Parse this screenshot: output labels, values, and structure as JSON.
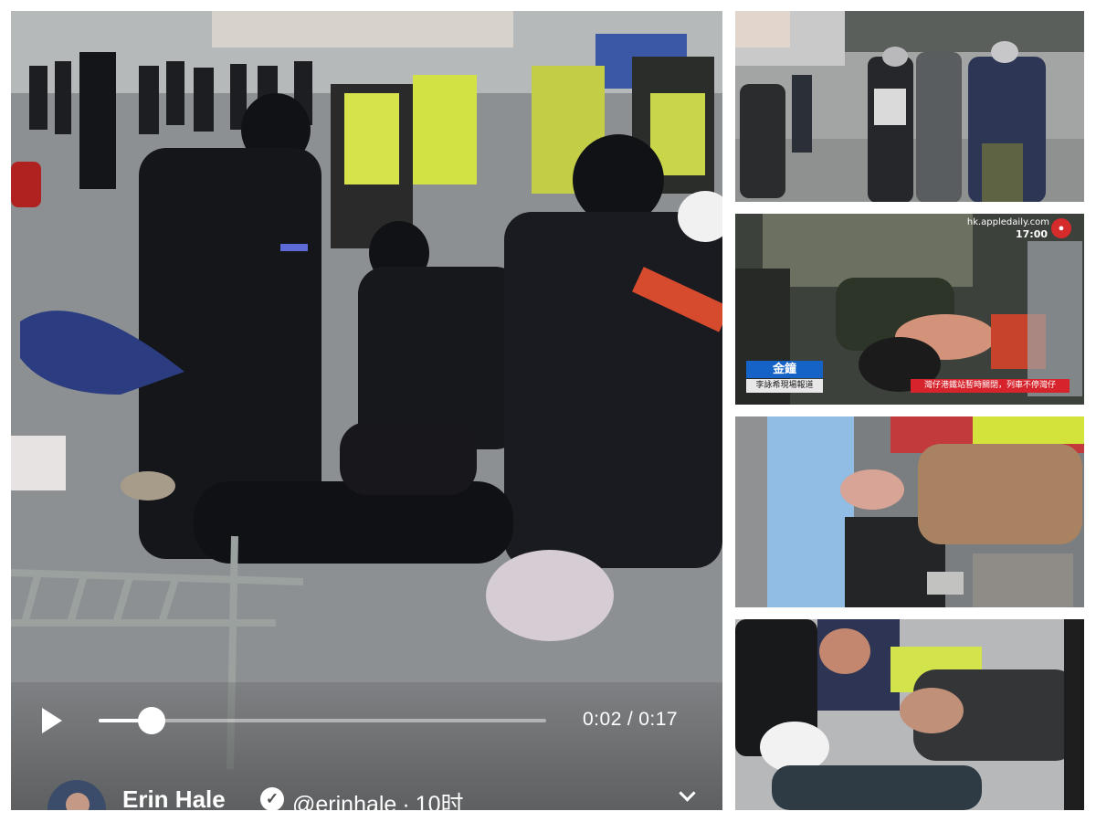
{
  "video": {
    "current_time": "0:02",
    "separator": "/",
    "duration": "0:17",
    "progress_fraction": 0.118
  },
  "post": {
    "author_name": "Erin Hale",
    "verified_glyph": "✓",
    "handle": "@erinhale",
    "dot": "·",
    "age": "10时"
  },
  "broadcast": {
    "url": "hk.appledaily.com",
    "clock": "17:00",
    "reporter_name": "金鐘",
    "reporter_caption": "李詠希現場報道",
    "ticker": "灣仔港鐵站暫時關閉，列車不停灣仔"
  },
  "icons": {
    "play": "play-icon",
    "verified": "verified-badge-icon",
    "more": "chevron-down-icon",
    "broadcaster_logo": "apple-daily-logo-icon"
  },
  "colors": {
    "frame": "#ffffff",
    "verified": "#ffffff",
    "name_bar": "#1563c7",
    "ticker_bar": "#d7232b"
  }
}
